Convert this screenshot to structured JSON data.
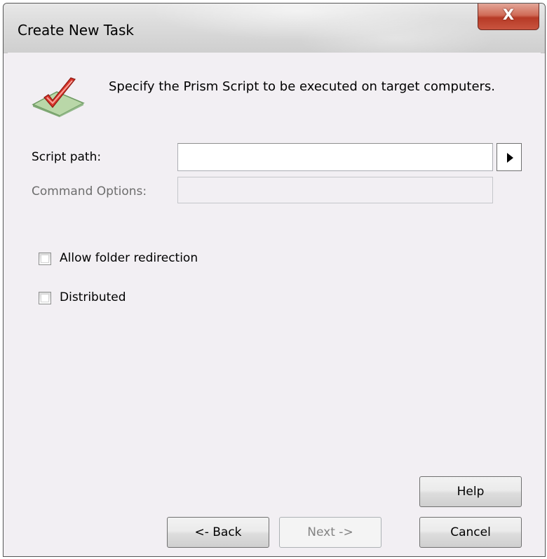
{
  "window": {
    "title": "Create New Task",
    "close_glyph": "X"
  },
  "header": {
    "icon": "checkmark-icon",
    "instruction": "Specify the Prism Script to be executed on target computers."
  },
  "form": {
    "script_path_label": "Script path:",
    "script_path_value": "",
    "command_options_label": "Command Options:",
    "command_options_value": "",
    "browse_icon": "triangle-right-icon"
  },
  "options": {
    "allow_folder_redirection": {
      "label": "Allow folder redirection",
      "checked": false
    },
    "distributed": {
      "label": "Distributed",
      "checked": false
    }
  },
  "buttons": {
    "help": "Help",
    "back": "<- Back",
    "next": "Next ->",
    "cancel": "Cancel"
  }
}
